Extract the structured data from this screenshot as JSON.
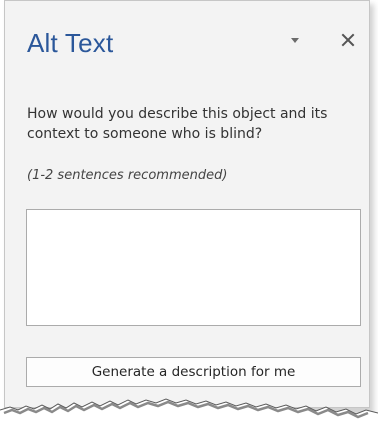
{
  "pane": {
    "title": "Alt Text",
    "options_icon": "triangle-down-icon",
    "close_icon": "close-icon"
  },
  "content": {
    "question": "How would you describe this object and its context to someone who is blind?",
    "hint": "(1-2 sentences recommended)",
    "description_value": "",
    "generate_button_label": "Generate a description for me"
  },
  "colors": {
    "title": "#2b579a",
    "pane_background": "#f3f3f3",
    "border": "#ababab"
  }
}
